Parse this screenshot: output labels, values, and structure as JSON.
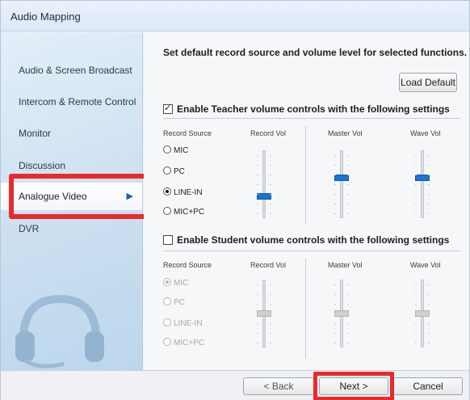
{
  "window": {
    "title": "Audio Mapping"
  },
  "sidebar": {
    "items": [
      {
        "label": "Audio & Screen Broadcast"
      },
      {
        "label": "Intercom & Remote Control"
      },
      {
        "label": "Monitor"
      },
      {
        "label": "Discussion"
      },
      {
        "label": "Analogue Video",
        "active": true
      },
      {
        "label": "DVR"
      }
    ]
  },
  "main": {
    "heading": "Set default record source and volume level for selected functions.",
    "load_default_label": "Load Default",
    "teacher": {
      "title": "Enable Teacher volume controls with the following settings",
      "enabled": true,
      "col_record_source": "Record Source",
      "col_record_vol": "Record Vol",
      "col_master_vol": "Master Vol",
      "col_wave_vol": "Wave Vol",
      "sources": [
        "MIC",
        "PC",
        "LINE-IN",
        "MIC+PC"
      ],
      "selected_source": "LINE-IN",
      "record_vol_level": 0.3,
      "master_vol_level": 0.6,
      "wave_vol_level": 0.6
    },
    "student": {
      "title": "Enable Student volume controls with the following settings",
      "enabled": false,
      "col_record_source": "Record Source",
      "col_record_vol": "Record Vol",
      "col_master_vol": "Master Vol",
      "col_wave_vol": "Wave Vol",
      "sources": [
        "MIC",
        "PC",
        "LINE-IN",
        "MIC+PC"
      ],
      "selected_source": "MIC",
      "record_vol_level": 0.5,
      "master_vol_level": 0.5,
      "wave_vol_level": 0.5
    }
  },
  "footer": {
    "back_label": "< Back",
    "next_label": "Next >",
    "cancel_label": "Cancel"
  },
  "colors": {
    "accent": "#1a73d6",
    "highlight": "#ea2a2a"
  }
}
